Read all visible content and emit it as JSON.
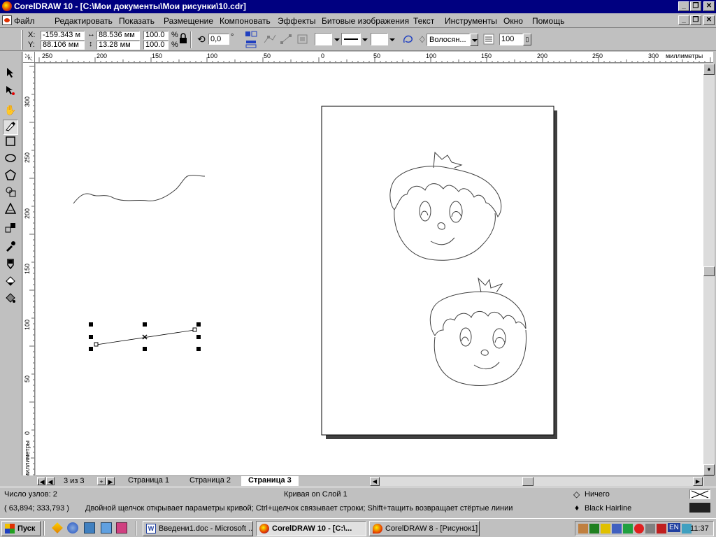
{
  "titlebar": {
    "title": "CorelDRAW 10 - [C:\\Мои документы\\Мои рисунки\\10.cdr]"
  },
  "menu": [
    "Файл",
    "Редактировать",
    "Показать",
    "Размещение",
    "Компоновать",
    "Эффекты",
    "Битовые изображения",
    "Текст",
    "Инструменты",
    "Окно",
    "Помощь"
  ],
  "propbar": {
    "x_label": "X:",
    "x_value": "-159.343 м",
    "y_label": "Y:",
    "y_value": "88.106 мм",
    "w_value": "88.536 мм",
    "h_value": "13.28 мм",
    "scale_x": "100.0",
    "scale_y": "100.0",
    "pct": "%",
    "rotation": "0,0",
    "degree": "°",
    "outline_width": "Волосян...",
    "smoothing": "100"
  },
  "rulers": {
    "h_ticks": [
      "250",
      "200",
      "150",
      "100",
      "50",
      "0",
      "50",
      "100",
      "150",
      "200",
      "250",
      "300"
    ],
    "h_unit": "миллиметры",
    "v_ticks": [
      "300",
      "250",
      "200",
      "150",
      "100",
      "50",
      "0"
    ],
    "v_unit": "миллиметры"
  },
  "tabs": {
    "page_count": "3 из 3",
    "pages": [
      "Страница 1",
      "Страница 2",
      "Страница 3"
    ],
    "active": "Страница 3"
  },
  "status": {
    "nodes": "Число узлов: 2",
    "layer": "Кривая on Слой 1",
    "coords": "( 63,894; 333,793 )",
    "hint": "Двойной щелчок открывает параметры кривой; Ctrl+щелчок связывает строки; Shift+тащить возвращает стёртые линии",
    "fill": "Ничего",
    "outline": "Black  Hairline"
  },
  "taskbar": {
    "start": "Пуск",
    "tasks": [
      "Введени1.doc - Microsoft ...",
      "CorelDRAW 10 - [C:\\...",
      "CorelDRAW 8 - [Рисунок1]"
    ],
    "lang": "EN",
    "clock": "11:37"
  },
  "colors": {
    "titlebar": "#000080",
    "chrome": "#c0c0c0",
    "canvas": "#ffffff",
    "page_shadow": "#404040"
  }
}
